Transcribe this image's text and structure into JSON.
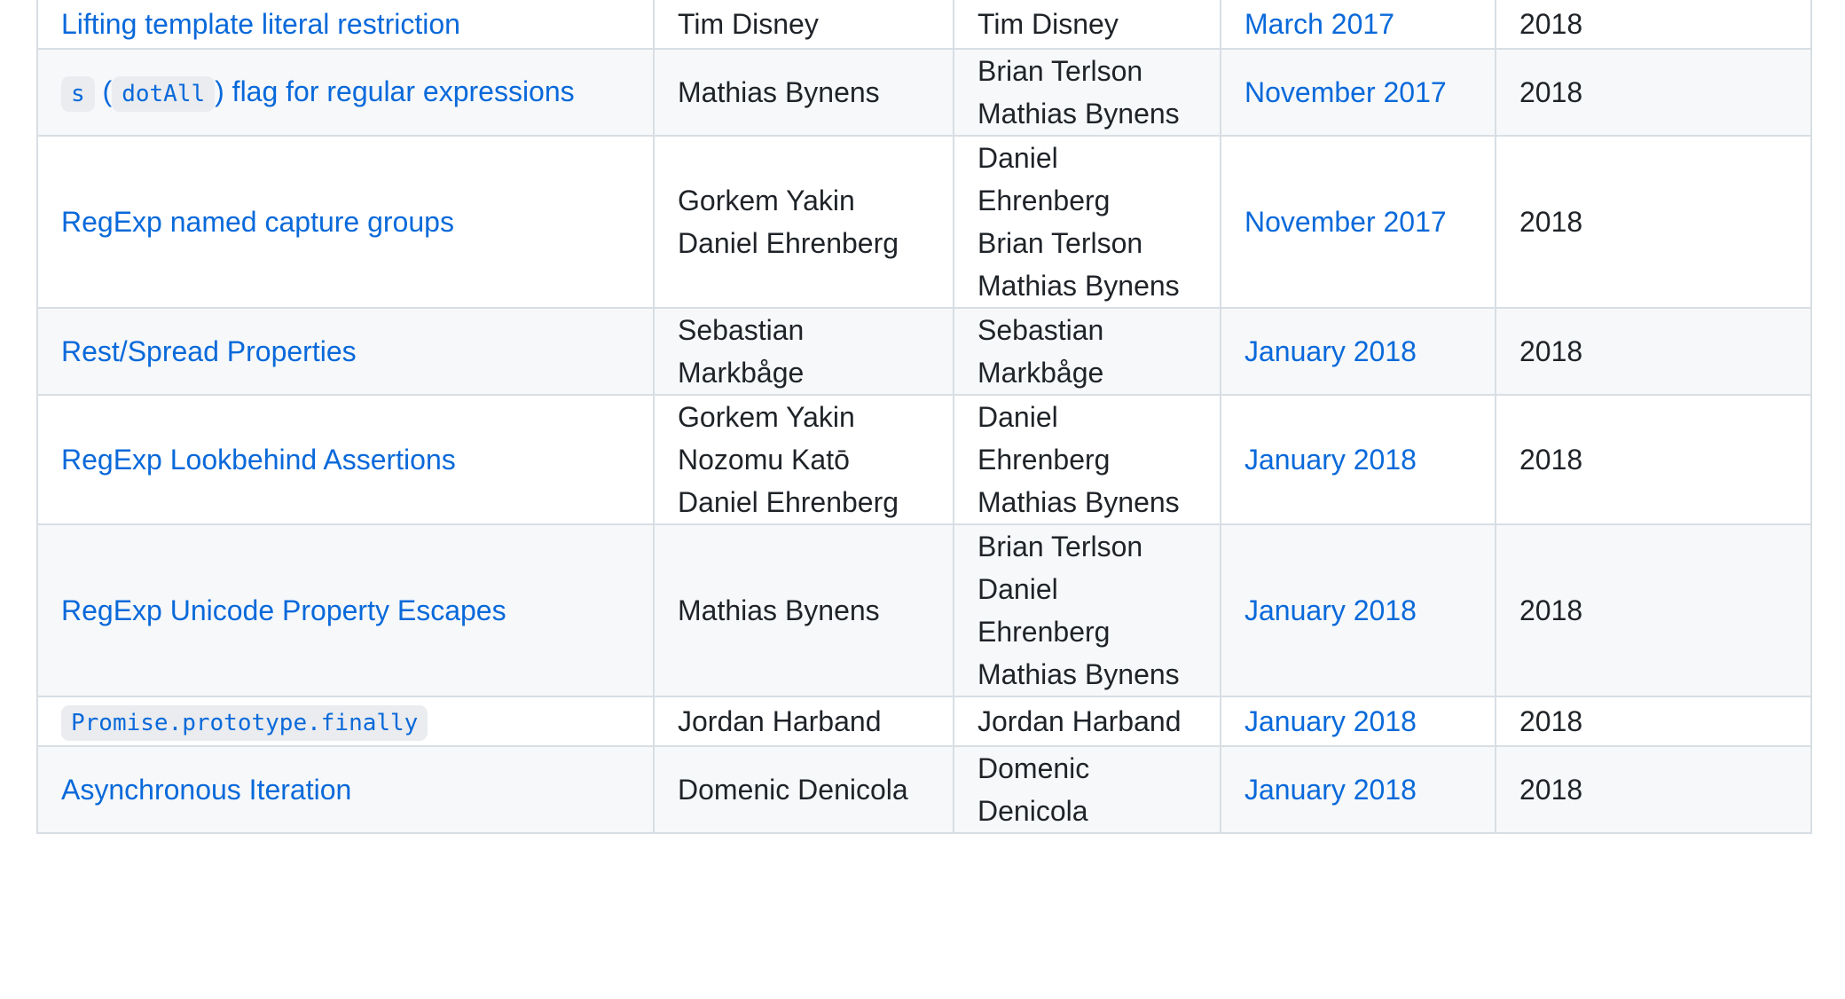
{
  "rows": [
    {
      "proposal": {
        "parts": [
          {
            "type": "text",
            "text": "Lifting template literal restriction"
          }
        ]
      },
      "authors": [
        "Tim Disney"
      ],
      "champions": [
        "Tim Disney"
      ],
      "meeting": "March 2017",
      "year": "2018"
    },
    {
      "proposal": {
        "parts": [
          {
            "type": "code",
            "text": "s"
          },
          {
            "type": "text",
            "text": " ("
          },
          {
            "type": "code",
            "text": "dotAll"
          },
          {
            "type": "text",
            "text": ") flag for regular expressions"
          }
        ]
      },
      "authors": [
        "Mathias Bynens"
      ],
      "champions": [
        "Brian Terlson",
        "Mathias Bynens"
      ],
      "meeting": "November 2017",
      "year": "2018"
    },
    {
      "proposal": {
        "parts": [
          {
            "type": "text",
            "text": "RegExp named capture groups"
          }
        ]
      },
      "authors": [
        "Gorkem Yakin",
        "Daniel Ehrenberg"
      ],
      "champions": [
        "Daniel",
        "Ehrenberg",
        "Brian Terlson",
        "Mathias Bynens"
      ],
      "meeting": "November 2017",
      "year": "2018"
    },
    {
      "proposal": {
        "parts": [
          {
            "type": "text",
            "text": "Rest/Spread Properties"
          }
        ]
      },
      "authors": [
        "Sebastian",
        "Markbåge"
      ],
      "champions": [
        "Sebastian",
        "Markbåge"
      ],
      "meeting": "January 2018",
      "year": "2018"
    },
    {
      "proposal": {
        "parts": [
          {
            "type": "text",
            "text": "RegExp Lookbehind Assertions"
          }
        ]
      },
      "authors": [
        "Gorkem Yakin",
        "Nozomu Katō",
        "Daniel Ehrenberg"
      ],
      "champions": [
        "Daniel",
        "Ehrenberg",
        "Mathias Bynens"
      ],
      "meeting": "January 2018",
      "year": "2018"
    },
    {
      "proposal": {
        "parts": [
          {
            "type": "text",
            "text": "RegExp Unicode Property Escapes"
          }
        ]
      },
      "authors": [
        "Mathias Bynens"
      ],
      "champions": [
        "Brian Terlson",
        "Daniel",
        "Ehrenberg",
        "Mathias Bynens"
      ],
      "meeting": "January 2018",
      "year": "2018"
    },
    {
      "proposal": {
        "parts": [
          {
            "type": "code",
            "text": "Promise.prototype.finally"
          }
        ]
      },
      "authors": [
        "Jordan Harband"
      ],
      "champions": [
        "Jordan Harband"
      ],
      "meeting": "January 2018",
      "year": "2018"
    },
    {
      "proposal": {
        "parts": [
          {
            "type": "text",
            "text": "Asynchronous Iteration"
          }
        ]
      },
      "authors": [
        "Domenic Denicola"
      ],
      "champions": [
        "Domenic",
        "Denicola"
      ],
      "meeting": "January 2018",
      "year": "2018"
    }
  ],
  "colors": {
    "link": "#0969da",
    "text": "#1f2328",
    "border": "#d8dee4",
    "row_alt": "#f6f8fa",
    "code_bg": "#eaecef"
  }
}
